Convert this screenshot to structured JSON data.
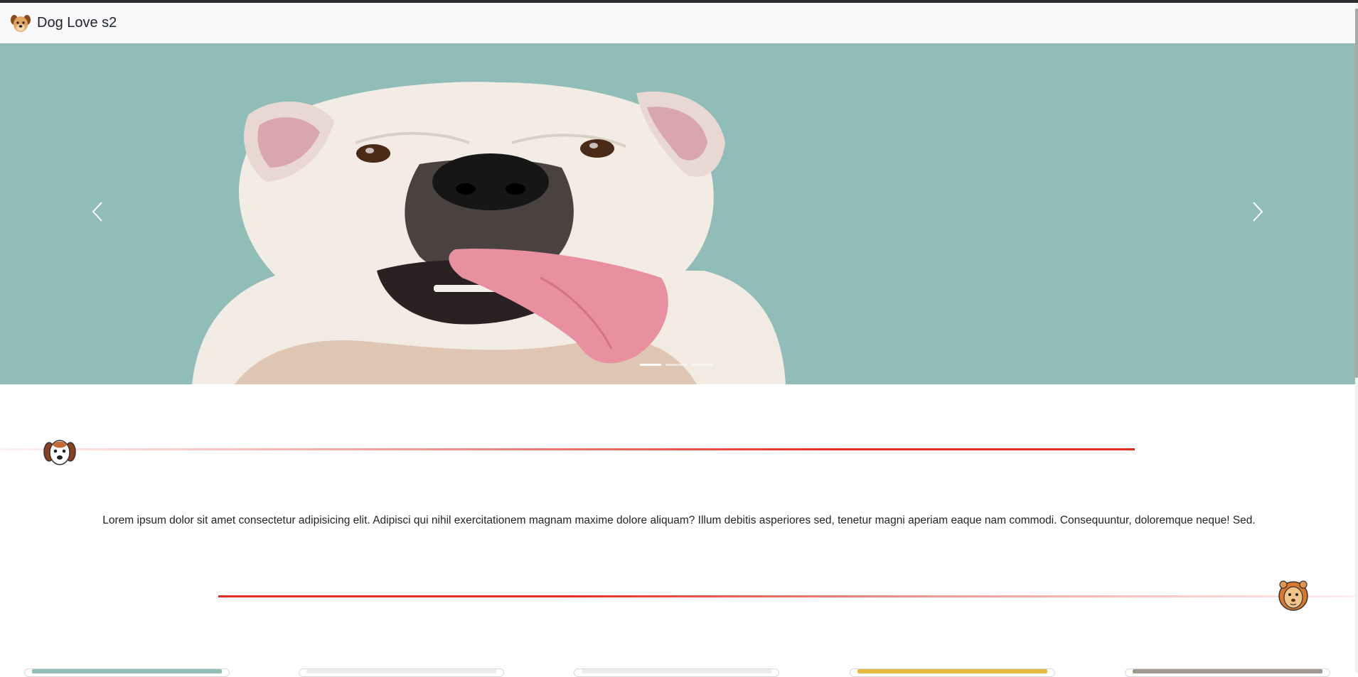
{
  "navbar": {
    "brand_text": "Dog Love s2",
    "brand_icon": "dog-face-icon"
  },
  "carousel": {
    "image": "white-bulldog-photo",
    "prev_icon": "chevron-left-icon",
    "next_icon": "chevron-right-icon",
    "slide_count": 3,
    "active_slide": 1,
    "background_color": "#90bdb8"
  },
  "dividers": {
    "top_icon": "dog-face-icon",
    "bottom_icon": "lion-face-icon",
    "line_color": "#e32a1e"
  },
  "intro_text": "Lorem ipsum dolor sit amet consectetur adipisicing elit. Adipisci qui nihil exercitationem magnam maxime dolore aliquam? Illum debitis asperiores sed, tenetur magni aperiam eaque nam commodi. Consequuntur, doloremque neque! Sed.",
  "cards": [
    {
      "accent": "#90bdb8"
    },
    {
      "accent": "#ececec"
    },
    {
      "accent": "#ececec"
    },
    {
      "accent": "#e7b93e"
    },
    {
      "accent": "#a3988d"
    }
  ]
}
